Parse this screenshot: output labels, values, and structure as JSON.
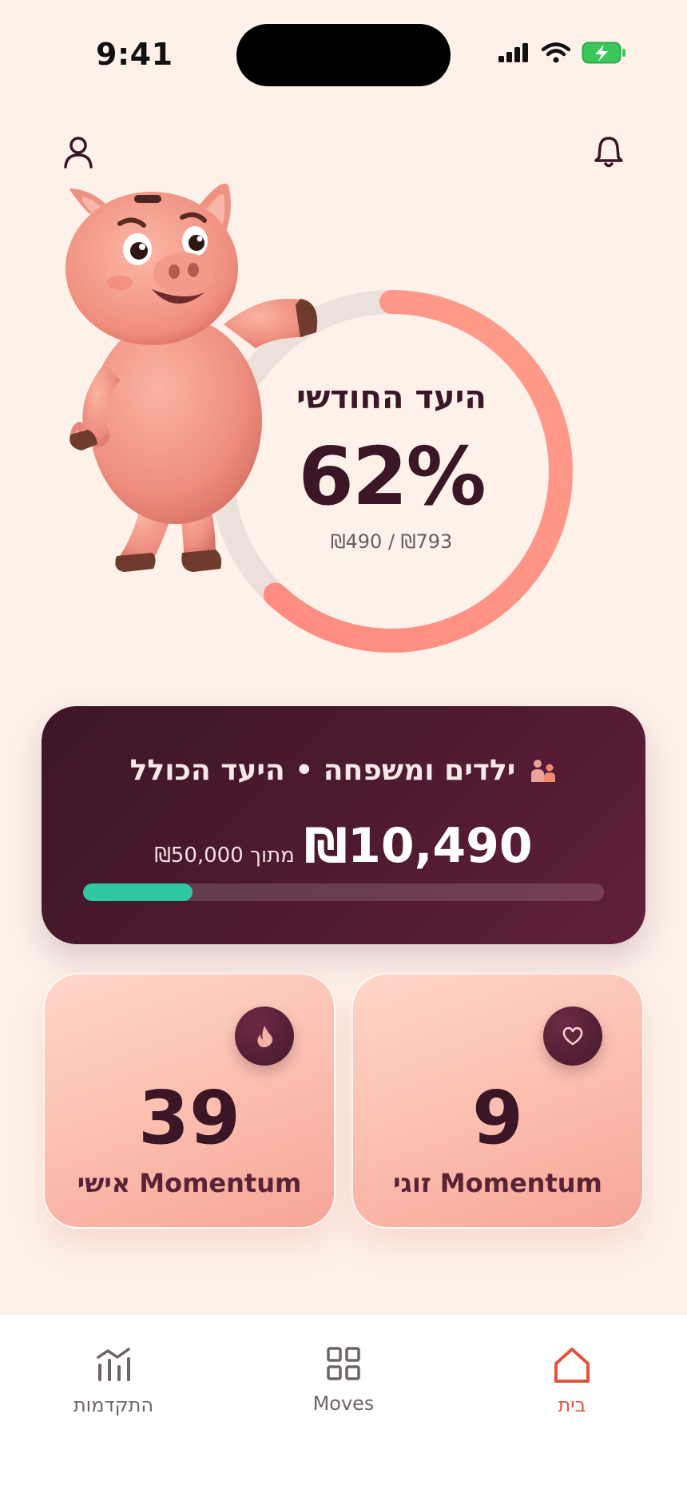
{
  "status_bar": {
    "time": "9:41"
  },
  "header": {
    "left_icon": "user-icon",
    "right_icon": "bell-icon"
  },
  "monthly_goal": {
    "title": "היעד החודשי",
    "percent_label": "62%",
    "progress_percent": 62,
    "amount": "₪490 / ₪793"
  },
  "family_goal": {
    "icon": "family-icon",
    "title": "ילדים ומשפחה • היעד הכולל",
    "current": "₪10,490",
    "of_text": "מתוך ₪50,000",
    "progress_percent": 21,
    "colors": {
      "track_fill": "#2ec9a0",
      "card": "#4d1a30"
    }
  },
  "momentum": [
    {
      "value": "9",
      "label": "Momentum זוגי",
      "icon": "heart-icon"
    },
    {
      "value": "39",
      "label": "Momentum אישי",
      "icon": "flame-icon"
    }
  ],
  "bottom_nav": {
    "items": [
      {
        "label": "בית",
        "icon": "home-icon",
        "active": true
      },
      {
        "label": "Moves",
        "icon": "grid-icon",
        "active": false
      },
      {
        "label": "התקדמות",
        "icon": "progress-chart-icon",
        "active": false
      }
    ],
    "accent_color": "#e0533d"
  },
  "mascot": {
    "name": "piggy-bank-mascot"
  }
}
